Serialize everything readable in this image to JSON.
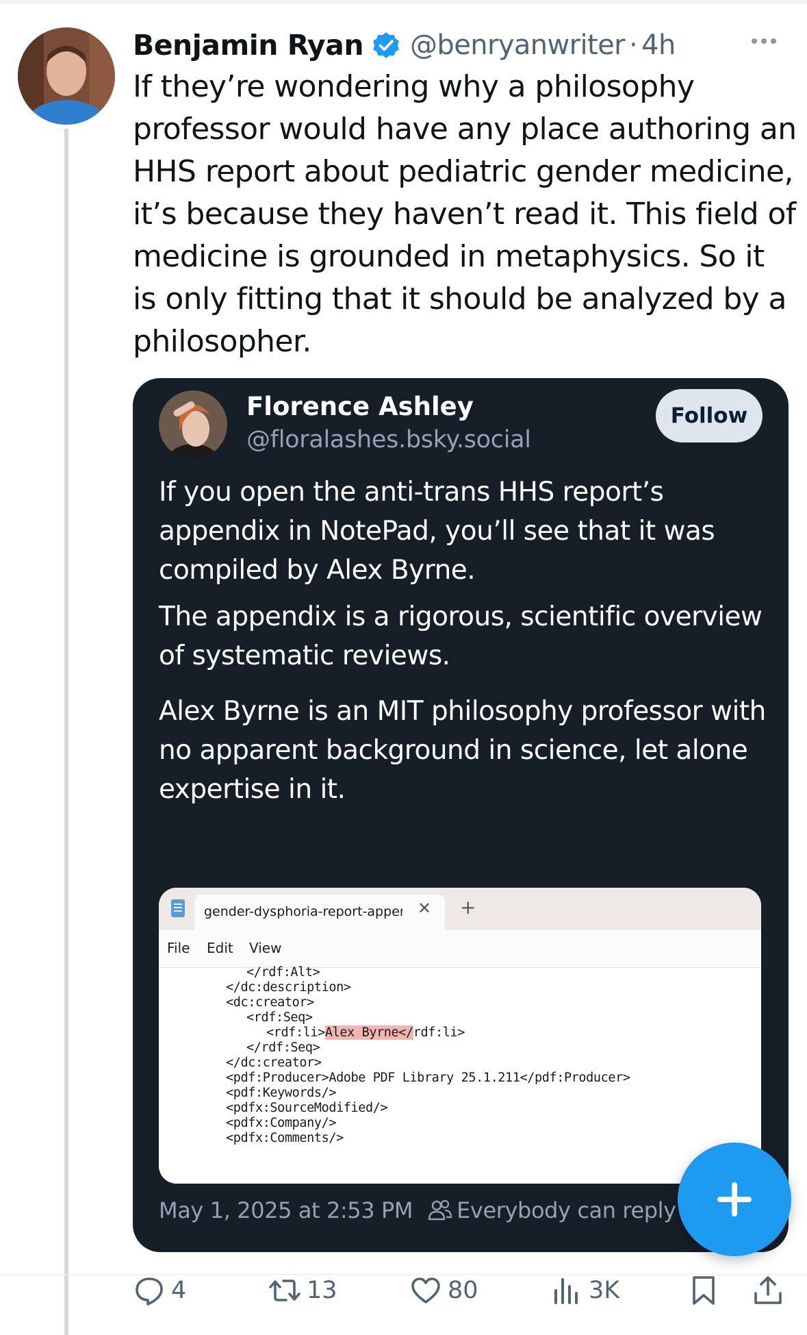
{
  "tweet": {
    "author_name": "Benjamin Ryan",
    "handle": "@benryanwriter",
    "separator": "·",
    "time": "4h",
    "text": "If they’re wondering why a philosophy professor would have any place authoring an HHS report about pediatric gender medicine, it’s because they haven’t read it. This field of medicine is grounded in metaphysics. So it is only fitting that it should be analyzed by a philosopher."
  },
  "embed": {
    "author_name": "Florence Ashley",
    "handle": "@floralashes.bsky.social",
    "follow_label": "Follow",
    "paragraphs": [
      "If you open the anti-trans HHS report’s appendix in NotePad, you’ll see that it was compiled by Alex Byrne.",
      "The appendix is a rigorous, scientific overview of systematic reviews.",
      "Alex Byrne is an MIT philosophy professor with no apparent background in science, let alone expertise in it."
    ],
    "timestamp": "May 1, 2025 at 2:53 PM",
    "reply_setting": "Everybody can reply"
  },
  "notepad": {
    "tab_title": "gender-dysphoria-report-appendi",
    "close_glyph": "✕",
    "new_tab_glyph": "+",
    "menu": [
      "File",
      "Edit",
      "View"
    ],
    "lines": [
      "</rdf:Alt>",
      "</dc:description>",
      "<dc:creator>",
      "<rdf:Seq>",
      "<rdf:li>",
      "Alex Byrne</",
      "rdf:li>",
      "</rdf:Seq>",
      "</dc:creator>",
      "<pdf:Producer>Adobe PDF Library 25.1.211</pdf:Producer>",
      "<pdf:Keywords/>",
      "<pdfx:SourceModified/>",
      "<pdfx:Company/>",
      "<pdfx:Comments/>"
    ]
  },
  "actions": {
    "replies": "4",
    "reposts": "13",
    "likes": "80",
    "views": "3K"
  },
  "colors": {
    "accent": "#1d9bf0",
    "embed_background": "#161e28",
    "highlight": "#f4b4b0"
  },
  "icons": [
    "verified-badge-icon",
    "more-icon",
    "notepad-file-icon",
    "people-icon",
    "plus-icon",
    "reply-icon",
    "repost-icon",
    "like-icon",
    "views-icon",
    "bookmark-icon",
    "share-icon"
  ]
}
